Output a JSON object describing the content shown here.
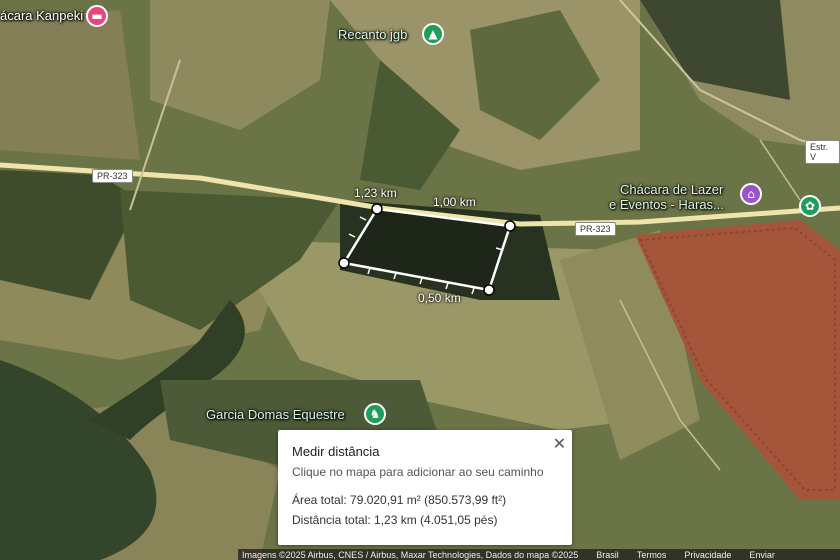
{
  "pois": {
    "chacara_kanpeki": "ácara Kanpeki",
    "recanto": "Recanto jgb",
    "chacara_lazer_line1": "Chácara de Lazer",
    "chacara_lazer_line2": "e Eventos - Haras...",
    "garcia": "Garcia Domas Equestre"
  },
  "roads": {
    "pr323_left": "PR-323",
    "pr323_right": "PR-323",
    "estr": "Estr. V"
  },
  "measurements": {
    "seg1": "1,23 km",
    "seg2": "1,00 km",
    "seg3": "0,50 km"
  },
  "panel": {
    "title": "Medir distância",
    "hint": "Clique no mapa para adicionar ao seu caminho",
    "area": "Área total: 79.020,91 m² (850.573,99 ft²)",
    "distance": "Distância total: 1,23 km (4.051,05 pés)",
    "close": "✕"
  },
  "footer": {
    "imagery": "Imagens ©2025 Airbus, CNES / Airbus, Maxar Technologies, Dados do mapa ©2025",
    "country": "Brasil",
    "terms": "Termos",
    "privacy": "Privacidade",
    "send": "Enviar"
  },
  "colors": {
    "pin_pink": "#e8457a",
    "pin_green": "#1e9e5a",
    "pin_purple": "#9c52c9",
    "road": "#f2e7b0"
  }
}
